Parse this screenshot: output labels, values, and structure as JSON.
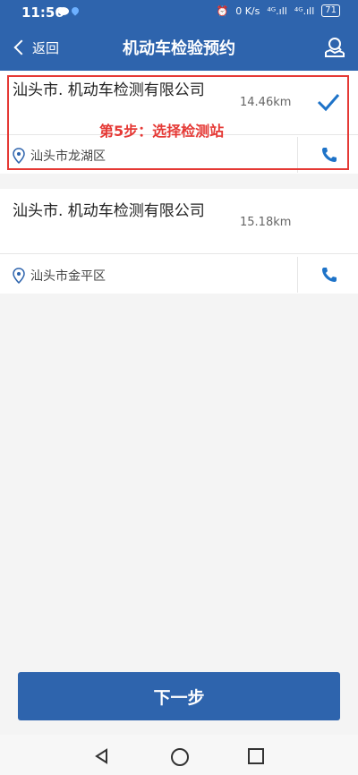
{
  "status_bar": {
    "time": "11:56",
    "battery": "71",
    "net": "0 K/s",
    "signal1": "⁴ᴳ.ıll",
    "signal2": "⁴ᴳ.ıll"
  },
  "header": {
    "back_label": "返回",
    "title": "机动车检验预约"
  },
  "stations": [
    {
      "name": "汕头市.   机动车检测有限公司",
      "distance": "14.46km",
      "address": "汕头市龙湖区",
      "selected": true
    },
    {
      "name": "汕头市.     机动车检测有限公司",
      "distance": "15.18km",
      "address": "汕头市金平区",
      "selected": false
    }
  ],
  "annotation": "第5步：选择检测站",
  "next_button": "下一步",
  "colors": {
    "primary": "#2e64ad",
    "annotation": "#e53935",
    "accent": "#1e73c8"
  },
  "icons": [
    "map-search-icon",
    "location-pin-icon",
    "phone-icon",
    "checkmark-icon"
  ]
}
